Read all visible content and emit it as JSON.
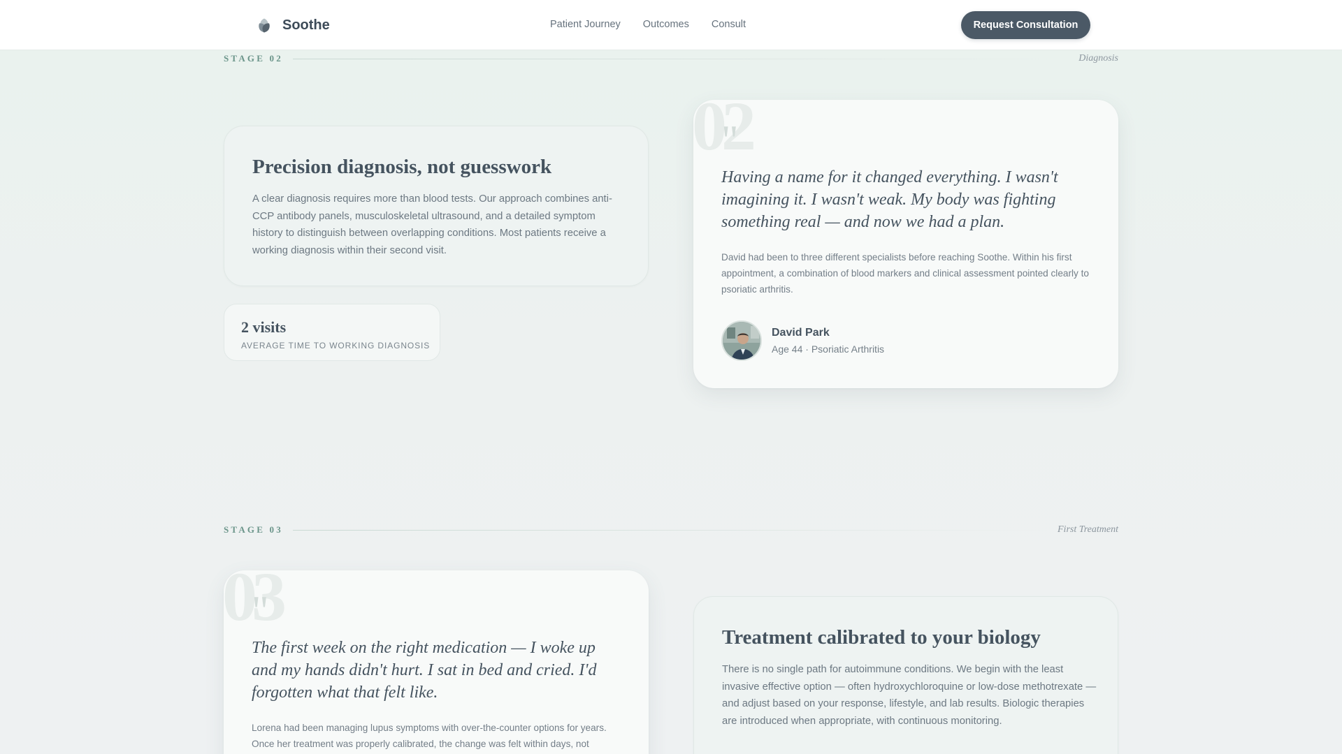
{
  "nav": {
    "brand": "Soothe",
    "links": [
      "Patient Journey",
      "Outcomes",
      "Consult"
    ],
    "cta_label": "Request Consultation"
  },
  "stage2": {
    "label": "STAGE 02",
    "name": "Diagnosis",
    "info": {
      "title": "Precision diagnosis, not guesswork",
      "body": "A clear diagnosis requires more than blood tests. Our approach combines anti-CCP antibody panels, musculoskeletal ultrasound, and a detailed symptom history to distinguish between overlapping conditions. Most patients receive a working diagnosis within their second visit."
    },
    "stat": {
      "value": "2 visits",
      "label": "AVERAGE TIME TO WORKING DIAGNOSIS"
    },
    "testimonial": {
      "number": "02",
      "quote_mark": "\"",
      "quote": "Having a name for it changed everything. I wasn't imagining it. I wasn't weak. My body was fighting something real — and now we had a plan.",
      "body": "David had been to three different specialists before reaching Soothe. Within his first appointment, a combination of blood markers and clinical assessment pointed clearly to psoriatic arthritis.",
      "author_name": "David Park",
      "author_meta": "Age 44 · Psoriatic Arthritis"
    }
  },
  "stage3": {
    "label": "STAGE 03",
    "name": "First Treatment",
    "testimonial": {
      "number": "03",
      "quote_mark": "\"",
      "quote": "The first week on the right medication — I woke up and my hands didn't hurt. I sat in bed and cried. I'd forgotten what that felt like.",
      "body": "Lorena had been managing lupus symptoms with over-the-counter options for years. Once her treatment was properly calibrated, the change was felt within days, not"
    },
    "info": {
      "title": "Treatment calibrated to your biology",
      "body": "There is no single path for autoimmune conditions. We begin with the least invasive effective option — often hydroxychloroquine or low-dose methotrexate — and adjust based on your response, lifestyle, and lab results. Biologic therapies are introduced when appropriate, with continuous monitoring."
    }
  }
}
